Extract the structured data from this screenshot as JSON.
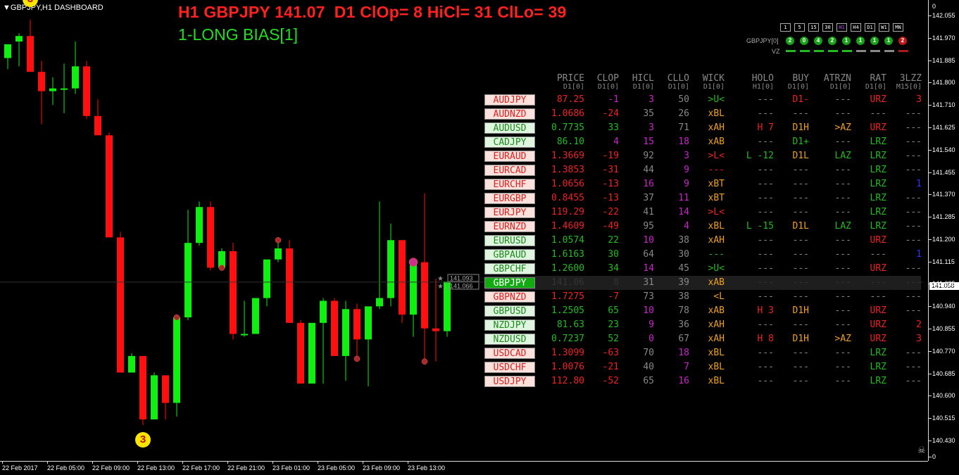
{
  "window": {
    "title_symbol": "▼GBPJPY,H1 DASHBOARD"
  },
  "headline": {
    "text": "H1 GBPJPY 141.07  D1 ClOp= 8 HiCl= 31 ClLo= 39",
    "bias": "1-LONG BIAS[1]"
  },
  "colors": {
    "bull": "#11ee11",
    "bear": "#ff1010",
    "accent": "#ff2020",
    "bias": "#22dd22",
    "background": "#000000"
  },
  "chart_data": {
    "type": "candlestick",
    "ylim": [
      140.43,
      142.055
    ],
    "y_ticks": [
      "142.055",
      "141.970",
      "141.885",
      "141.800",
      "141.710",
      "141.625",
      "141.540",
      "141.455",
      "141.370",
      "141.285",
      "141.200",
      "141.115",
      "141.025",
      "140.940",
      "140.855",
      "140.770",
      "140.685",
      "140.600",
      "140.515",
      "140.430"
    ],
    "y_top_label": "0",
    "y_bottom_label": "0",
    "current_price": "141.058",
    "price_tags": [
      "141.093",
      "141.066"
    ],
    "x_ticks": [
      "22 Feb 2017",
      "22 Feb 05:00",
      "22 Feb 09:00",
      "22 Feb 13:00",
      "22 Feb 17:00",
      "22 Feb 21:00",
      "23 Feb 01:00",
      "23 Feb 05:00",
      "23 Feb 09:00",
      "23 Feb 13:00"
    ],
    "candles": [
      {
        "o": 141.87,
        "h": 141.92,
        "l": 141.83,
        "c": 141.92
      },
      {
        "o": 141.93,
        "h": 141.96,
        "l": 141.84,
        "c": 141.95
      },
      {
        "o": 141.95,
        "h": 142.01,
        "l": 141.82,
        "c": 141.82
      },
      {
        "o": 141.82,
        "h": 141.86,
        "l": 141.63,
        "c": 141.75
      },
      {
        "o": 141.75,
        "h": 141.8,
        "l": 141.7,
        "c": 141.76
      },
      {
        "o": 141.76,
        "h": 141.85,
        "l": 141.67,
        "c": 141.76
      },
      {
        "o": 141.76,
        "h": 141.93,
        "l": 141.74,
        "c": 141.84
      },
      {
        "o": 141.84,
        "h": 141.86,
        "l": 141.65,
        "c": 141.66
      },
      {
        "o": 141.66,
        "h": 141.72,
        "l": 141.59,
        "c": 141.59
      },
      {
        "o": 141.59,
        "h": 141.6,
        "l": 141.22,
        "c": 141.22
      },
      {
        "o": 141.22,
        "h": 141.24,
        "l": 140.73,
        "c": 140.73
      },
      {
        "o": 140.73,
        "h": 140.8,
        "l": 140.73,
        "c": 140.79
      },
      {
        "o": 140.79,
        "h": 140.79,
        "l": 140.54,
        "c": 140.56
      },
      {
        "o": 140.56,
        "h": 140.73,
        "l": 140.56,
        "c": 140.72
      },
      {
        "o": 140.72,
        "h": 140.72,
        "l": 140.56,
        "c": 140.62
      },
      {
        "o": 140.62,
        "h": 140.93,
        "l": 140.57,
        "c": 140.93
      },
      {
        "o": 140.93,
        "h": 141.32,
        "l": 140.92,
        "c": 141.2
      },
      {
        "o": 141.2,
        "h": 141.35,
        "l": 141.19,
        "c": 141.33
      },
      {
        "o": 141.33,
        "h": 141.35,
        "l": 141.1,
        "c": 141.11
      },
      {
        "o": 141.11,
        "h": 141.18,
        "l": 141.11,
        "c": 141.17
      },
      {
        "o": 141.17,
        "h": 141.2,
        "l": 140.85,
        "c": 140.87
      },
      {
        "o": 140.87,
        "h": 140.99,
        "l": 140.86,
        "c": 140.87
      },
      {
        "o": 140.87,
        "h": 141.0,
        "l": 140.87,
        "c": 141.0
      },
      {
        "o": 141.0,
        "h": 141.14,
        "l": 140.97,
        "c": 141.14
      },
      {
        "o": 141.14,
        "h": 141.21,
        "l": 141.13,
        "c": 141.18
      },
      {
        "o": 141.18,
        "h": 141.21,
        "l": 140.91,
        "c": 140.91
      },
      {
        "o": 140.91,
        "h": 140.92,
        "l": 140.69,
        "c": 140.69
      },
      {
        "o": 140.69,
        "h": 140.91,
        "l": 140.69,
        "c": 140.91
      },
      {
        "o": 140.91,
        "h": 141.0,
        "l": 140.69,
        "c": 140.99
      },
      {
        "o": 140.99,
        "h": 141.0,
        "l": 140.79,
        "c": 140.79
      },
      {
        "o": 140.79,
        "h": 140.99,
        "l": 140.7,
        "c": 140.96
      },
      {
        "o": 140.96,
        "h": 140.98,
        "l": 140.78,
        "c": 140.85
      },
      {
        "o": 140.85,
        "h": 140.95,
        "l": 140.68,
        "c": 140.97
      },
      {
        "o": 140.97,
        "h": 141.35,
        "l": 140.96,
        "c": 141.0
      },
      {
        "o": 141.0,
        "h": 141.27,
        "l": 140.97,
        "c": 141.21
      },
      {
        "o": 141.21,
        "h": 141.21,
        "l": 140.91,
        "c": 140.94
      },
      {
        "o": 140.94,
        "h": 141.13,
        "l": 140.86,
        "c": 141.13
      },
      {
        "o": 141.13,
        "h": 141.38,
        "l": 140.77,
        "c": 140.89
      },
      {
        "o": 140.89,
        "h": 141.07,
        "l": 140.77,
        "c": 140.88
      },
      {
        "o": 140.88,
        "h": 141.06,
        "l": 140.86,
        "c": 141.06
      }
    ],
    "badges": [
      {
        "text": "3",
        "candle": 2,
        "pos": "above"
      },
      {
        "text": "3",
        "candle": 12,
        "pos": "below"
      }
    ]
  },
  "timeframes": {
    "buttons": [
      "1",
      "5",
      "15",
      "30",
      "H1",
      "H4",
      "D1",
      "W1",
      "MN"
    ],
    "selected": "H1"
  },
  "signals": {
    "label": "GBPJPY[0]",
    "vz_label": "VZ",
    "dots": [
      {
        "value": "2",
        "state": "up"
      },
      {
        "value": "0",
        "state": "up"
      },
      {
        "value": "4",
        "state": "up"
      },
      {
        "value": "2",
        "state": "up"
      },
      {
        "value": "1",
        "state": "up"
      },
      {
        "value": "1",
        "state": "up"
      },
      {
        "value": "1",
        "state": "up"
      },
      {
        "value": "1",
        "state": "up"
      },
      {
        "value": "2",
        "state": "down"
      }
    ],
    "bars": [
      "#22bb22",
      "#22bb22",
      "#22bb22",
      "#22bb22",
      "#22bb22",
      "#888888",
      "#888888",
      "#888888",
      "#aa1a1a"
    ]
  },
  "dashboard": {
    "columns": [
      {
        "key": "price",
        "label": "PRICE",
        "sub": "D1[0]"
      },
      {
        "key": "clop",
        "label": "CLOP",
        "sub": "D1[0]"
      },
      {
        "key": "hicl",
        "label": "HICL",
        "sub": "D1[0]"
      },
      {
        "key": "cllo",
        "label": "CLLO",
        "sub": "D1[0]"
      },
      {
        "key": "wick",
        "label": "WICK",
        "sub": "D1[0]"
      },
      {
        "key": "holo",
        "label": "HOLO",
        "sub": "H1[0]"
      },
      {
        "key": "buy",
        "label": "BUY",
        "sub": "D1[0]"
      },
      {
        "key": "atrzn",
        "label": "ATRZN",
        "sub": "D1[0]"
      },
      {
        "key": "rat",
        "label": "RAT",
        "sub": "D1[0]"
      },
      {
        "key": "lzz",
        "label": "3LZZ",
        "sub": "M15[0]"
      }
    ],
    "rows": [
      {
        "symbol": "AUDJPY",
        "dir": "dn",
        "price": "87.25",
        "pc": "red",
        "clop": "-1",
        "cc": "mag",
        "hicl": "3",
        "hc": "mag",
        "cllo": "50",
        "lc": "gray",
        "wick": ">U<",
        "wc": "green",
        "holo": "---",
        "hoc": "gray",
        "buy": "D1-",
        "bc": "red",
        "atrzn": "---",
        "ac": "gray",
        "rat": "URZ",
        "rc": "red",
        "lzz": "3",
        "zc": "red"
      },
      {
        "symbol": "AUDNZD",
        "dir": "dn",
        "price": "1.0686",
        "pc": "red",
        "clop": "-24",
        "cc": "red",
        "hicl": "35",
        "hc": "gray",
        "cllo": "26",
        "lc": "gray",
        "wick": "xBL",
        "wc": "orange",
        "holo": "---",
        "hoc": "gray",
        "buy": "---",
        "bc": "gray",
        "atrzn": "---",
        "ac": "gray",
        "rat": "---",
        "rc": "gray",
        "lzz": "---",
        "zc": "gray"
      },
      {
        "symbol": "AUDUSD",
        "dir": "up",
        "price": "0.7735",
        "pc": "green",
        "clop": "33",
        "cc": "green",
        "hicl": "3",
        "hc": "mag",
        "cllo": "71",
        "lc": "gray",
        "wick": "xAH",
        "wc": "orange",
        "holo": "H 7",
        "hoc": "red",
        "buy": "D1H",
        "bc": "orange",
        "atrzn": ">AZ",
        "ac": "orange",
        "rat": "URZ",
        "rc": "red",
        "lzz": "---",
        "zc": "gray"
      },
      {
        "symbol": "CADJPY",
        "dir": "up",
        "price": "86.10",
        "pc": "green",
        "clop": "4",
        "cc": "mag",
        "hicl": "15",
        "hc": "mag",
        "cllo": "18",
        "lc": "mag",
        "wick": "xAB",
        "wc": "orange",
        "holo": "---",
        "hoc": "gray",
        "buy": "D1+",
        "bc": "green",
        "atrzn": "---",
        "ac": "gray",
        "rat": "LRZ",
        "rc": "green",
        "lzz": "---",
        "zc": "gray"
      },
      {
        "symbol": "EURAUD",
        "dir": "dn",
        "price": "1.3669",
        "pc": "red",
        "clop": "-19",
        "cc": "red",
        "hicl": "92",
        "hc": "gray",
        "cllo": "3",
        "lc": "mag",
        "wick": ">L<",
        "wc": "red",
        "holo": "L -12",
        "hoc": "green",
        "buy": "D1L",
        "bc": "orange",
        "atrzn": "LAZ",
        "ac": "green",
        "rat": "LRZ",
        "rc": "green",
        "lzz": "---",
        "zc": "gray"
      },
      {
        "symbol": "EURCAD",
        "dir": "dn",
        "price": "1.3853",
        "pc": "red",
        "clop": "-31",
        "cc": "red",
        "hicl": "44",
        "hc": "gray",
        "cllo": "9",
        "lc": "mag",
        "wick": "---",
        "wc": "red",
        "holo": "---",
        "hoc": "gray",
        "buy": "---",
        "bc": "gray",
        "atrzn": "---",
        "ac": "gray",
        "rat": "LRZ",
        "rc": "green",
        "lzz": "---",
        "zc": "gray"
      },
      {
        "symbol": "EURCHF",
        "dir": "dn",
        "price": "1.0656",
        "pc": "red",
        "clop": "-13",
        "cc": "red",
        "hicl": "16",
        "hc": "mag",
        "cllo": "9",
        "lc": "mag",
        "wick": "xBT",
        "wc": "orange",
        "holo": "---",
        "hoc": "gray",
        "buy": "---",
        "bc": "gray",
        "atrzn": "---",
        "ac": "gray",
        "rat": "LRZ",
        "rc": "green",
        "lzz": "1",
        "zc": "blue"
      },
      {
        "symbol": "EURGBP",
        "dir": "dn",
        "price": "0.8455",
        "pc": "red",
        "clop": "-13",
        "cc": "red",
        "hicl": "37",
        "hc": "gray",
        "cllo": "11",
        "lc": "mag",
        "wick": "xBT",
        "wc": "orange",
        "holo": "---",
        "hoc": "gray",
        "buy": "---",
        "bc": "gray",
        "atrzn": "---",
        "ac": "gray",
        "rat": "LRZ",
        "rc": "green",
        "lzz": "---",
        "zc": "gray"
      },
      {
        "symbol": "EURJPY",
        "dir": "dn",
        "price": "119.29",
        "pc": "red",
        "clop": "-22",
        "cc": "red",
        "hicl": "41",
        "hc": "gray",
        "cllo": "14",
        "lc": "mag",
        "wick": ">L<",
        "wc": "red",
        "holo": "---",
        "hoc": "gray",
        "buy": "---",
        "bc": "gray",
        "atrzn": "---",
        "ac": "gray",
        "rat": "LRZ",
        "rc": "green",
        "lzz": "---",
        "zc": "gray"
      },
      {
        "symbol": "EURNZD",
        "dir": "dn",
        "price": "1.4609",
        "pc": "red",
        "clop": "-49",
        "cc": "red",
        "hicl": "95",
        "hc": "gray",
        "cllo": "4",
        "lc": "mag",
        "wick": "xBL",
        "wc": "orange",
        "holo": "L -15",
        "hoc": "green",
        "buy": "D1L",
        "bc": "orange",
        "atrzn": "LAZ",
        "ac": "green",
        "rat": "LRZ",
        "rc": "green",
        "lzz": "---",
        "zc": "gray"
      },
      {
        "symbol": "EURUSD",
        "dir": "up",
        "price": "1.0574",
        "pc": "green",
        "clop": "22",
        "cc": "green",
        "hicl": "10",
        "hc": "mag",
        "cllo": "38",
        "lc": "gray",
        "wick": "xAH",
        "wc": "orange",
        "holo": "---",
        "hoc": "gray",
        "buy": "---",
        "bc": "gray",
        "atrzn": "---",
        "ac": "gray",
        "rat": "URZ",
        "rc": "red",
        "lzz": "---",
        "zc": "gray"
      },
      {
        "symbol": "GBPAUD",
        "dir": "up",
        "price": "1.6163",
        "pc": "green",
        "clop": "30",
        "cc": "green",
        "hicl": "64",
        "hc": "gray",
        "cllo": "30",
        "lc": "gray",
        "wick": "---",
        "wc": "green",
        "holo": "---",
        "hoc": "gray",
        "buy": "---",
        "bc": "gray",
        "atrzn": "---",
        "ac": "gray",
        "rat": "---",
        "rc": "gray",
        "lzz": "1",
        "zc": "blue"
      },
      {
        "symbol": "GBPCHF",
        "dir": "up",
        "price": "1.2600",
        "pc": "green",
        "clop": "34",
        "cc": "green",
        "hicl": "14",
        "hc": "mag",
        "cllo": "45",
        "lc": "gray",
        "wick": ">U<",
        "wc": "green",
        "holo": "---",
        "hoc": "gray",
        "buy": "---",
        "bc": "gray",
        "atrzn": "---",
        "ac": "gray",
        "rat": "URZ",
        "rc": "red",
        "lzz": "---",
        "zc": "gray"
      },
      {
        "symbol": "GBPJPY",
        "dir": "act",
        "price": "141.06",
        "pc": "dark",
        "clop": "8",
        "cc": "dark",
        "hicl": "31",
        "hc": "gray",
        "cllo": "39",
        "lc": "gray",
        "wick": "xAB",
        "wc": "orange",
        "holo": "---",
        "hoc": "dark",
        "buy": "---",
        "bc": "dark",
        "atrzn": "---",
        "ac": "dark",
        "rat": "---",
        "rc": "dark",
        "lzz": "---",
        "zc": "dark"
      },
      {
        "symbol": "GBPNZD",
        "dir": "dn",
        "price": "1.7275",
        "pc": "red",
        "clop": "-7",
        "cc": "red",
        "hicl": "73",
        "hc": "gray",
        "cllo": "38",
        "lc": "gray",
        "wick": "<L",
        "wc": "orange",
        "holo": "---",
        "hoc": "gray",
        "buy": "---",
        "bc": "gray",
        "atrzn": "---",
        "ac": "gray",
        "rat": "---",
        "rc": "gray",
        "lzz": "---",
        "zc": "gray"
      },
      {
        "symbol": "GBPUSD",
        "dir": "up",
        "price": "1.2505",
        "pc": "green",
        "clop": "65",
        "cc": "green",
        "hicl": "10",
        "hc": "mag",
        "cllo": "78",
        "lc": "gray",
        "wick": "xAB",
        "wc": "orange",
        "holo": "H 3",
        "hoc": "red",
        "buy": "D1H",
        "bc": "orange",
        "atrzn": "---",
        "ac": "gray",
        "rat": "URZ",
        "rc": "red",
        "lzz": "---",
        "zc": "gray"
      },
      {
        "symbol": "NZDJPY",
        "dir": "up",
        "price": "81.63",
        "pc": "green",
        "clop": "23",
        "cc": "green",
        "hicl": "9",
        "hc": "mag",
        "cllo": "36",
        "lc": "gray",
        "wick": "xAH",
        "wc": "orange",
        "holo": "---",
        "hoc": "gray",
        "buy": "---",
        "bc": "gray",
        "atrzn": "---",
        "ac": "gray",
        "rat": "URZ",
        "rc": "red",
        "lzz": "2",
        "zc": "red"
      },
      {
        "symbol": "NZDUSD",
        "dir": "up",
        "price": "0.7237",
        "pc": "green",
        "clop": "52",
        "cc": "green",
        "hicl": "0",
        "hc": "mag",
        "cllo": "67",
        "lc": "gray",
        "wick": "xAH",
        "wc": "orange",
        "holo": "H 8",
        "hoc": "red",
        "buy": "D1H",
        "bc": "orange",
        "atrzn": ">AZ",
        "ac": "orange",
        "rat": "URZ",
        "rc": "red",
        "lzz": "3",
        "zc": "red"
      },
      {
        "symbol": "USDCAD",
        "dir": "dn",
        "price": "1.3099",
        "pc": "red",
        "clop": "-63",
        "cc": "red",
        "hicl": "70",
        "hc": "gray",
        "cllo": "18",
        "lc": "mag",
        "wick": "xBL",
        "wc": "orange",
        "holo": "---",
        "hoc": "gray",
        "buy": "---",
        "bc": "gray",
        "atrzn": "---",
        "ac": "gray",
        "rat": "LRZ",
        "rc": "green",
        "lzz": "---",
        "zc": "gray"
      },
      {
        "symbol": "USDCHF",
        "dir": "dn",
        "price": "1.0076",
        "pc": "red",
        "clop": "-21",
        "cc": "red",
        "hicl": "40",
        "hc": "gray",
        "cllo": "7",
        "lc": "mag",
        "wick": "xBL",
        "wc": "orange",
        "holo": "---",
        "hoc": "gray",
        "buy": "---",
        "bc": "gray",
        "atrzn": "---",
        "ac": "gray",
        "rat": "LRZ",
        "rc": "green",
        "lzz": "---",
        "zc": "gray"
      },
      {
        "symbol": "USDJPY",
        "dir": "dn",
        "price": "112.80",
        "pc": "red",
        "clop": "-52",
        "cc": "red",
        "hicl": "65",
        "hc": "gray",
        "cllo": "16",
        "lc": "mag",
        "wick": "xBL",
        "wc": "orange",
        "holo": "---",
        "hoc": "gray",
        "buy": "---",
        "bc": "gray",
        "atrzn": "---",
        "ac": "gray",
        "rat": "LRZ",
        "rc": "green",
        "lzz": "---",
        "zc": "gray"
      }
    ]
  }
}
